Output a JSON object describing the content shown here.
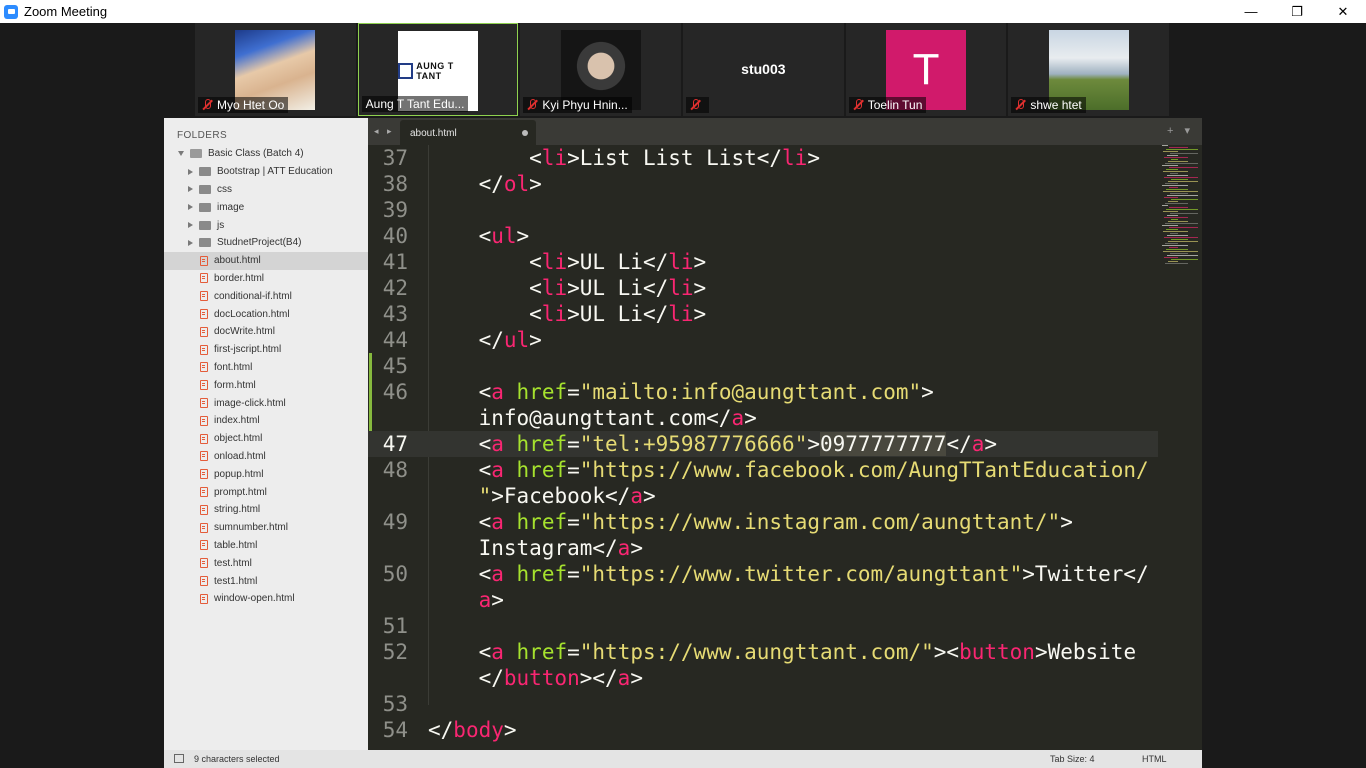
{
  "window": {
    "title": "Zoom Meeting",
    "controls": {
      "minimize": "—",
      "restore": "❐",
      "close": "✕"
    }
  },
  "participants": [
    {
      "name": "Myo Htet Oo",
      "avatar": "photo",
      "muted": true
    },
    {
      "name": "Aung T Tant Edu...",
      "avatar": "logo",
      "logo_text": "AUNG T TANT",
      "muted": false,
      "active_speaker": true
    },
    {
      "name": "Kyi Phyu Hnin...",
      "avatar": "photo",
      "muted": true
    },
    {
      "name": "stu003",
      "avatar": "none",
      "muted": true
    },
    {
      "name": "Toelin Tun",
      "avatar": "letter",
      "letter": "T",
      "avatar_color": "#d11a6b",
      "muted": true
    },
    {
      "name": "shwe htet",
      "avatar": "photo",
      "muted": true
    }
  ],
  "sidebar": {
    "header": "FOLDERS",
    "root": "Basic Class (Batch 4)",
    "folders": [
      "Bootstrap | ATT Education",
      "css",
      "image",
      "js",
      "StudnetProject(B4)"
    ],
    "files": [
      "about.html",
      "border.html",
      "conditional-if.html",
      "docLocation.html",
      "docWrite.html",
      "first-jscript.html",
      "font.html",
      "form.html",
      "image-click.html",
      "index.html",
      "object.html",
      "onload.html",
      "popup.html",
      "prompt.html",
      "string.html",
      "sumnumber.html",
      "table.html",
      "test.html",
      "test1.html",
      "window-open.html"
    ],
    "selected_file": "about.html"
  },
  "tabs": {
    "nav": "◂ ▸",
    "active": "about.html",
    "right_controls": "+ ▾"
  },
  "code": {
    "current_line": 47,
    "selection": "0977777777"
  },
  "status": {
    "selection": "9 characters selected",
    "tab_size": "Tab Size: 4",
    "syntax": "HTML"
  },
  "colors": {
    "tag": "#f92672",
    "attribute": "#a6e22e",
    "string": "#e6db74",
    "text": "#f8f8f2",
    "background": "#272822"
  }
}
